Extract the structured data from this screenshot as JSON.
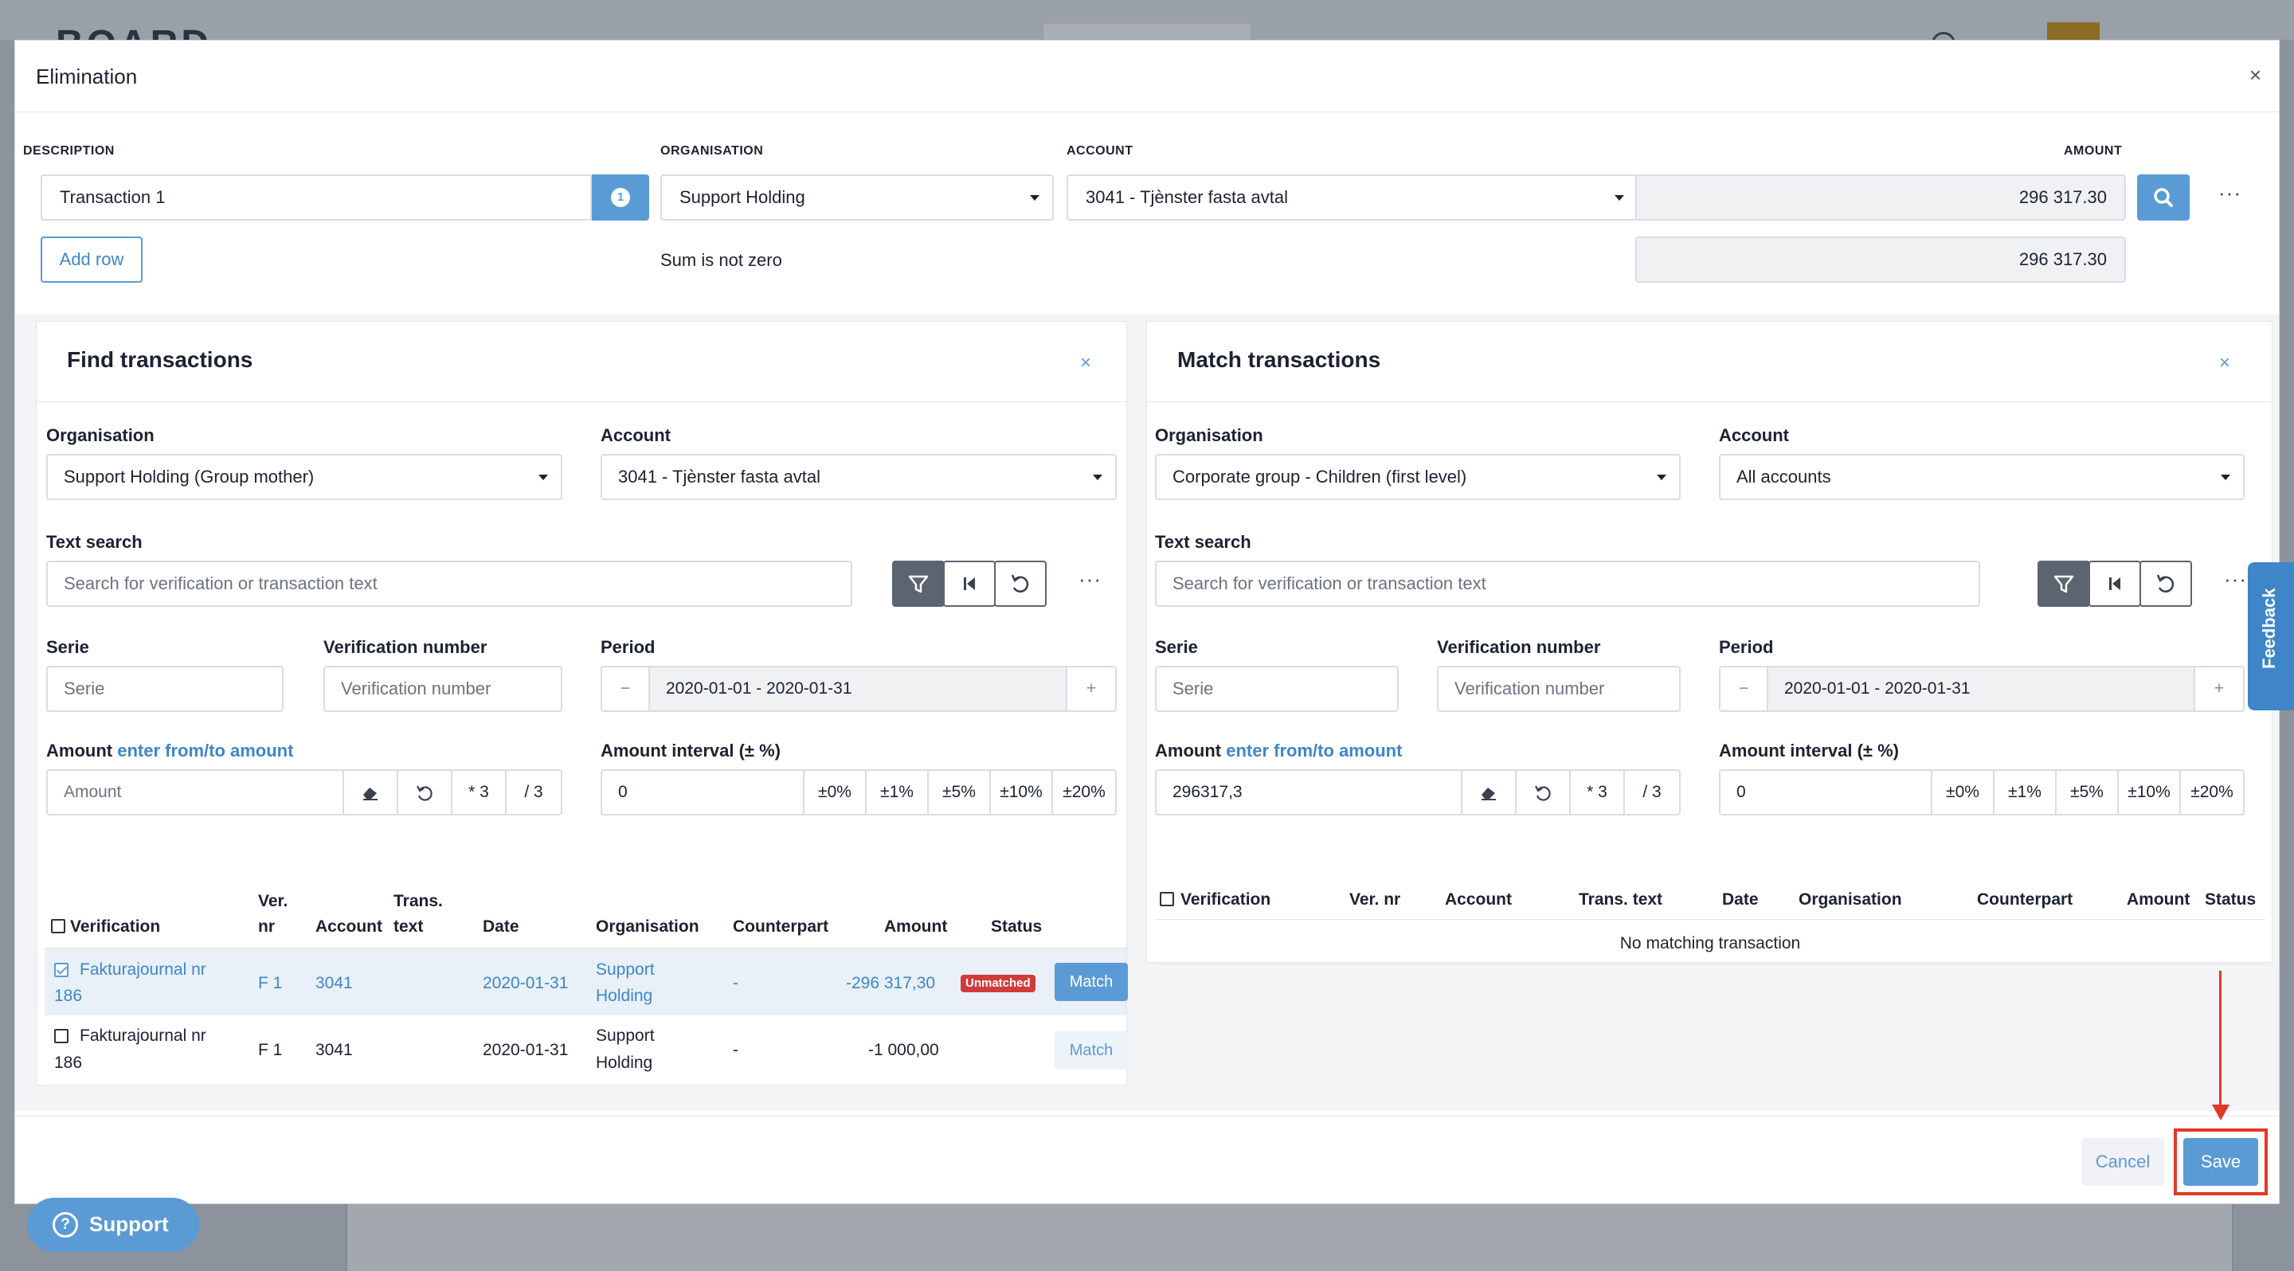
{
  "background": {
    "logo": "BOARD"
  },
  "modal": {
    "title": "Elimination",
    "close": "×"
  },
  "top_form": {
    "description_label": "DESCRIPTION",
    "organisation_label": "ORGANISATION",
    "account_label": "ACCOUNT",
    "amount_label": "AMOUNT",
    "description_value": "Transaction 1",
    "organisation_value": "Support Holding",
    "account_value": "3041 - Tjènster fasta avtal",
    "amount_value": "296 317.30",
    "info_badge": "1",
    "add_row_label": "Add row",
    "sum_message": "Sum is not zero",
    "sum_value": "296 317.30",
    "more": "···"
  },
  "find": {
    "title": "Find transactions",
    "close": "×",
    "organisation_label": "Organisation",
    "organisation_value": "Support Holding (Group mother)",
    "account_label": "Account",
    "account_value": "3041 - Tjènster fasta avtal",
    "text_search_label": "Text search",
    "text_search_placeholder": "Search for verification or transaction text",
    "more": "···",
    "serie_label": "Serie",
    "serie_placeholder": "Serie",
    "vernum_label": "Verification number",
    "vernum_placeholder": "Verification number",
    "period_label": "Period",
    "period_minus": "−",
    "period_value": "2020-01-01 - 2020-01-31",
    "period_plus": "+",
    "amount_label": "Amount",
    "amount_link": "enter from/to amount",
    "amount_placeholder": "Amount",
    "mult_label": "* 3",
    "div_label": "/ 3",
    "interval_label": "Amount interval (± %)",
    "interval_value": "0",
    "interval_options": [
      "±0%",
      "±1%",
      "±5%",
      "±10%",
      "±20%"
    ],
    "headers": {
      "verification": "Verification",
      "ver_nr_1": "Ver.",
      "ver_nr_2": "nr",
      "account": "Account",
      "trans_1": "Trans.",
      "trans_2": "text",
      "date": "Date",
      "organisation": "Organisation",
      "counterpart": "Counterpart",
      "amount": "Amount",
      "status": "Status"
    },
    "rows": [
      {
        "ver_line1": "Fakturajournal nr",
        "ver_line2": "186",
        "ver_nr": "F 1",
        "account": "3041",
        "date": "2020-01-31",
        "org_line1": "Support",
        "org_line2": "Holding",
        "counterpart": "-",
        "amount": "-296 317,30",
        "status": "Unmatched",
        "action": "Match"
      },
      {
        "ver_line1": "Fakturajournal nr",
        "ver_line2": "186",
        "ver_nr": "F 1",
        "account": "3041",
        "date": "2020-01-31",
        "org_line1": "Support",
        "org_line2": "Holding",
        "counterpart": "-",
        "amount": "-1 000,00",
        "status": "",
        "action": "Match"
      }
    ]
  },
  "match": {
    "title": "Match transactions",
    "close": "×",
    "organisation_label": "Organisation",
    "organisation_value": "Corporate group - Children (first level)",
    "account_label": "Account",
    "account_value": "All accounts",
    "text_search_label": "Text search",
    "text_search_placeholder": "Search for verification or transaction text",
    "more": "···",
    "serie_label": "Serie",
    "serie_placeholder": "Serie",
    "vernum_label": "Verification number",
    "vernum_placeholder": "Verification number",
    "period_label": "Period",
    "period_minus": "−",
    "period_value": "2020-01-01 - 2020-01-31",
    "period_plus": "+",
    "amount_label": "Amount",
    "amount_link": "enter from/to amount",
    "amount_value": "296317,3",
    "mult_label": "* 3",
    "div_label": "/ 3",
    "interval_label": "Amount interval (± %)",
    "interval_value": "0",
    "interval_options": [
      "±0%",
      "±1%",
      "±5%",
      "±10%",
      "±20%"
    ],
    "headers": {
      "verification": "Verification",
      "ver_nr": "Ver. nr",
      "account": "Account",
      "trans_text": "Trans. text",
      "date": "Date",
      "organisation": "Organisation",
      "counterpart": "Counterpart",
      "amount": "Amount",
      "status": "Status"
    },
    "empty": "No matching transaction"
  },
  "footer": {
    "cancel": "Cancel",
    "save": "Save"
  },
  "widgets": {
    "feedback": "Feedback",
    "support": "Support",
    "support_icon": "?"
  },
  "colors": {
    "primary": "#5b9bd5",
    "danger": "#d23b3b",
    "annotation": "#e0392a"
  }
}
